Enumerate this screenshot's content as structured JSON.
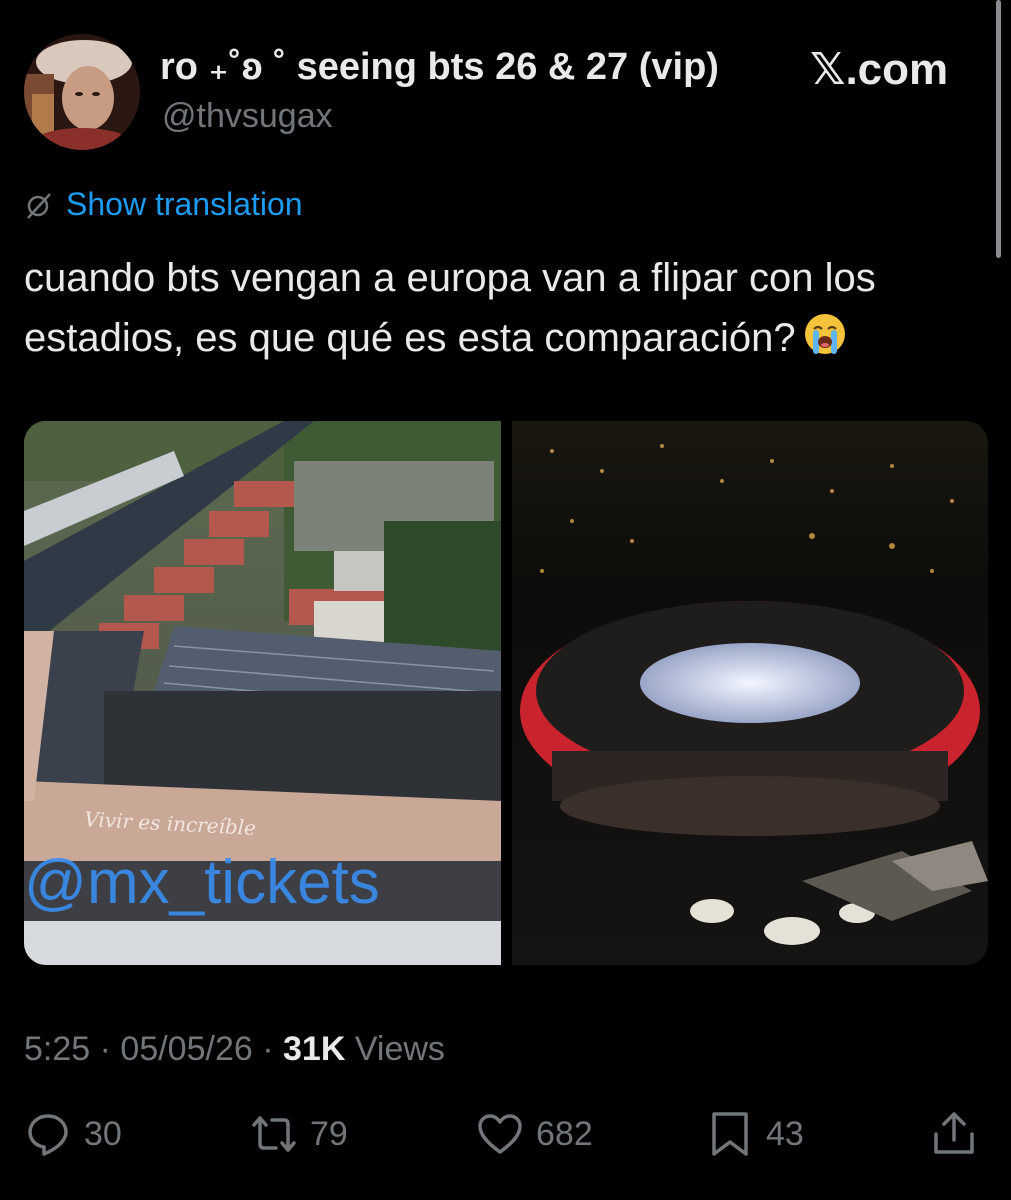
{
  "author": {
    "display_name": "ro ₊˚ʚ ˚ seeing bts 26 & 27 (vip)",
    "handle": "@thvsugax"
  },
  "source": "𝕏.com",
  "translation": {
    "label": "Show translation"
  },
  "tweet": {
    "text": "cuando bts vengan a europa van a flipar con los estadios, es que qué es esta comparación?",
    "emoji": "loudly-crying-face"
  },
  "media": {
    "left_image_text": [
      "Vivir es increíble",
      "@mx_tickets"
    ],
    "right_image": "night-stadium-red"
  },
  "meta": {
    "time": "5:25",
    "separator": "·",
    "date": "05/05/26",
    "views_count": "31K",
    "views_label": "Views"
  },
  "actions": {
    "replies": "30",
    "reposts": "79",
    "likes": "682",
    "bookmarks": "43"
  },
  "colors": {
    "background": "#000000",
    "text": "#e7e9ea",
    "muted": "#71767b",
    "link": "#1d9bf0"
  }
}
